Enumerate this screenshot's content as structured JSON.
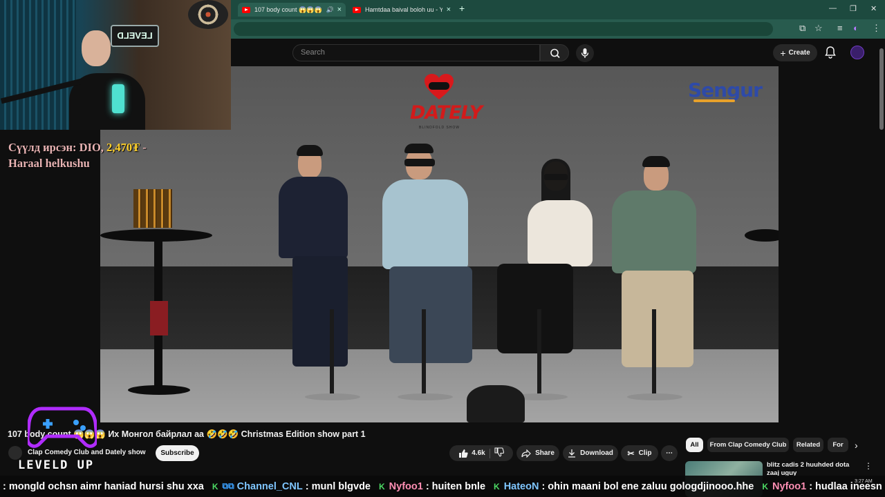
{
  "browser": {
    "tabs": [
      {
        "label": "107 body count 😱😱😱",
        "active": true
      },
      {
        "label": "Hamtdaa baival boloh uu - You",
        "active": false
      }
    ],
    "new_tab": "+",
    "window_controls": {
      "minimize": "—",
      "restore": "❐",
      "close": "✕"
    }
  },
  "youtube": {
    "search_placeholder": "Search",
    "create_label": "Create",
    "video": {
      "title": "107 body count 😱😱😱 Их Монгол байрлал аа 🤣🤣🤣 Christmas Edition show part 1",
      "show_logo": "DATELY",
      "show_logo_sub": "BLINDFOLD SHOW",
      "sponsor_logo": "Sengur"
    },
    "channel": {
      "name": "Clap Comedy Club and Dately show",
      "subscribe_label": "Subscribe"
    },
    "actions": {
      "likes": "4.6k",
      "share": "Share",
      "download": "Download",
      "clip": "Clip"
    },
    "chips": [
      "All",
      "From Clap Comedy Club",
      "Related",
      "For"
    ],
    "recommended": {
      "title": "blitz cadis 2 huuhded dota zaaj uguy"
    }
  },
  "stream_overlay": {
    "donation_prefix": "Сүүлд ирсэн: DIO, ",
    "donation_amount": "2,470₮",
    "donation_suffix": " -",
    "donation_msg": "Haraal helkushu",
    "brand": "LEVELD UP",
    "clock": "3:27 AM",
    "ticker": [
      {
        "user": "",
        "msg": ": mongld ochsn aimr haniad hursi shu xxa"
      },
      {
        "user": "Channel_CNL",
        "msg": ": munl blgvde"
      },
      {
        "user": "Nyfoo1",
        "msg": ": huiten bnle"
      },
      {
        "user": "HateoN",
        "msg": ": ohin maani bol ene zaluu gologdjinooo.hhe"
      },
      {
        "user": "Nyfoo1",
        "msg": ": hudlaa ineesn hum"
      }
    ]
  },
  "colors": {
    "accent_red": "#ff0000",
    "tab_green": "#1d4a3f",
    "donation_gold": "#ffd02a"
  }
}
